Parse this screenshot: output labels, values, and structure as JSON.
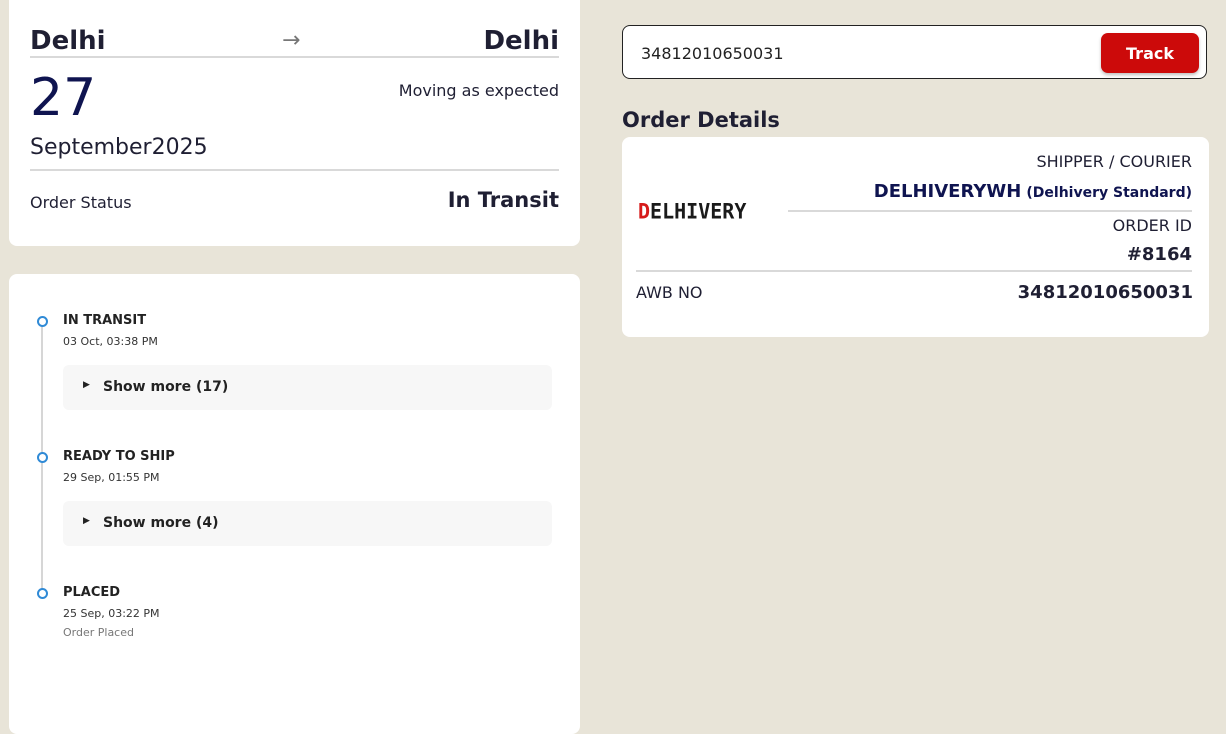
{
  "summary": {
    "origin": "Delhi",
    "destination": "Delhi",
    "arrow_icon": "arrow-right-icon",
    "day": "27",
    "month_year": "September2025",
    "eta_status": "Moving as expected",
    "status_label": "Order Status",
    "status_value": "In Transit"
  },
  "timeline": [
    {
      "title": "IN TRANSIT",
      "time": "03 Oct, 03:38 PM",
      "show_more": "Show more (17)"
    },
    {
      "title": "READY TO SHIP",
      "time": "29 Sep, 01:55 PM",
      "show_more": "Show more (4)"
    },
    {
      "title": "PLACED",
      "time": "25 Sep, 03:22 PM",
      "note": "Order Placed"
    }
  ],
  "search": {
    "value": "34812010650031",
    "button_label": "Track"
  },
  "order_details": {
    "heading": "Order Details",
    "logo_text": "DELHIVERY",
    "shipper_label": "SHIPPER / COURIER",
    "courier_name": "DELHIVERYWH",
    "courier_service": "(Delhivery Standard)",
    "order_id_label": "ORDER ID",
    "order_id": "#8164",
    "awb_label": "AWB NO",
    "awb_value": "34812010650031"
  },
  "colors": {
    "background": "#e8e4d8",
    "accent_red": "#cc0a0a",
    "navy": "#0f1450",
    "timeline_dot": "#2f8ad6"
  }
}
